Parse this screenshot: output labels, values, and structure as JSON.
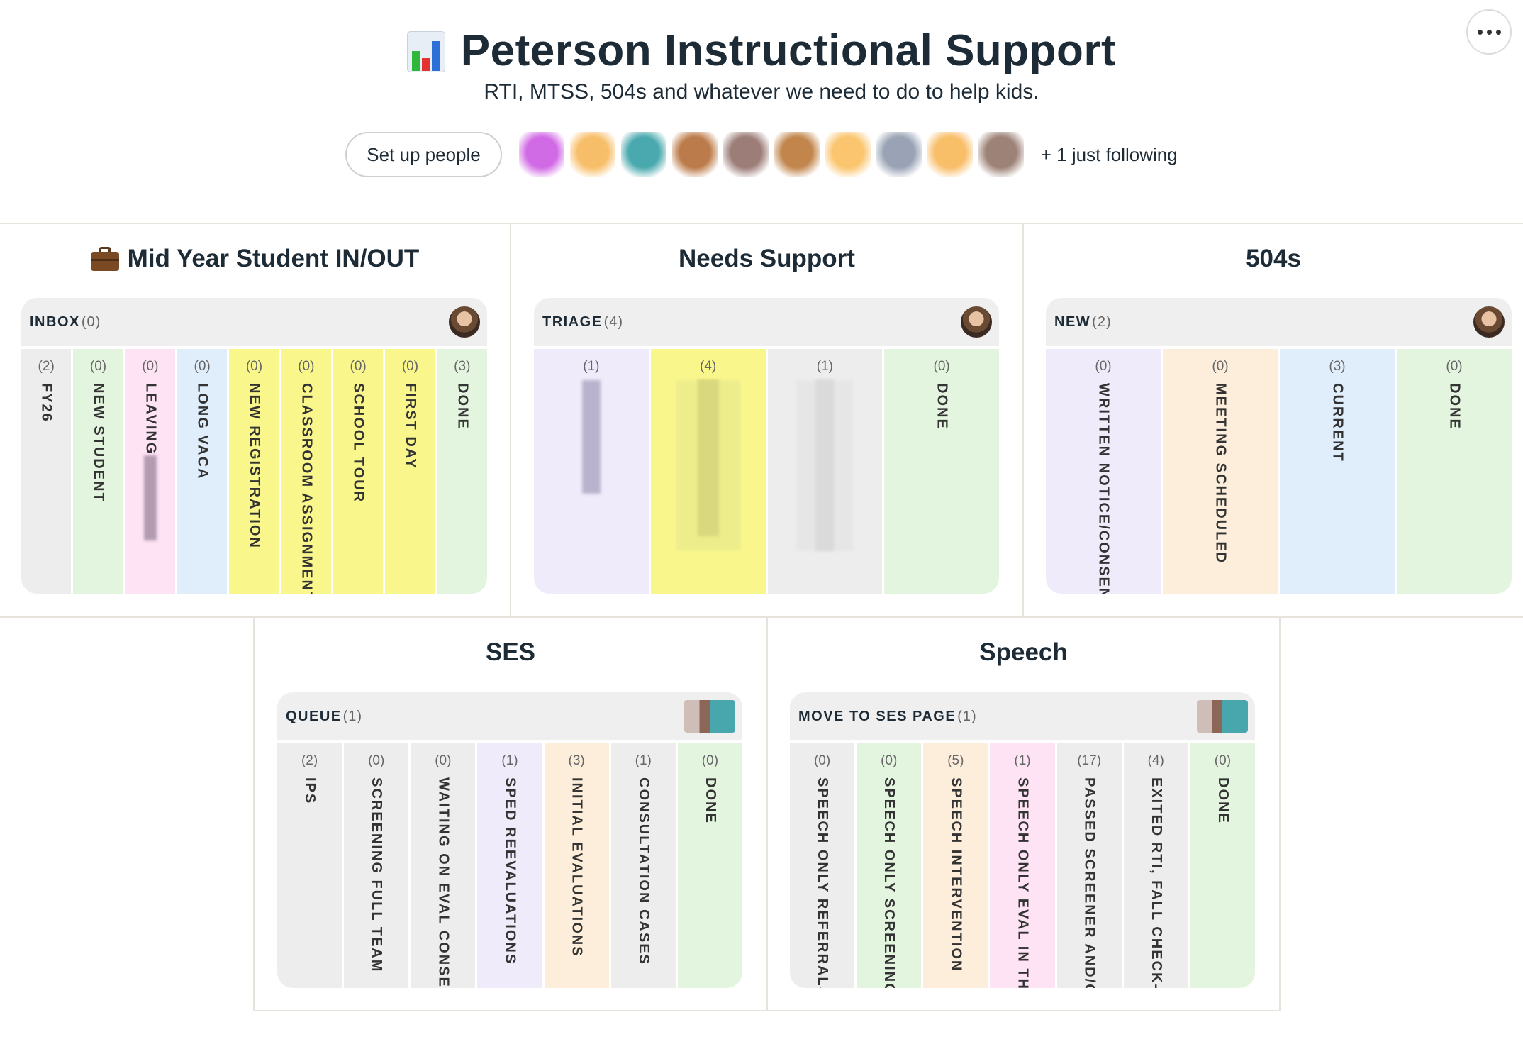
{
  "header": {
    "title": "Peterson Instructional Support",
    "subtitle": "RTI, MTSS, 504s and whatever we need to do to help kids.",
    "title_icon": "bar-chart-icon"
  },
  "people": {
    "setup_label": "Set up people",
    "following_label": "+ 1 just following",
    "avatar_colors": [
      "#c94fe0",
      "#f6b34f",
      "#2a9aa0",
      "#b0642a",
      "#8a6660",
      "#b7712d",
      "#f9bb55",
      "#8893a8",
      "#f8b24e",
      "#8c6c5f"
    ]
  },
  "more_menu": {
    "icon": "more-horizontal-icon"
  },
  "projects": [
    {
      "title": "Mid Year Student IN/OUT",
      "icon": "briefcase-icon",
      "board": {
        "name": "INBOX",
        "count": "(0)",
        "columns": [
          {
            "count": "(2)",
            "name": "FY26",
            "color": "#ededed"
          },
          {
            "count": "(0)",
            "name": "NEW STUDENT",
            "color": "#e3f5df"
          },
          {
            "count": "(0)",
            "name": "LEAVING",
            "color": "#fde3f4"
          },
          {
            "count": "(0)",
            "name": "LONG VACA",
            "color": "#e0eefb"
          },
          {
            "count": "(0)",
            "name": "NEW REGISTRATION",
            "color": "#f9f78c"
          },
          {
            "count": "(0)",
            "name": "CLASSROOM ASSIGNMENT",
            "color": "#f9f78c"
          },
          {
            "count": "(0)",
            "name": "SCHOOL TOUR",
            "color": "#f9f78c"
          },
          {
            "count": "(0)",
            "name": "FIRST DAY",
            "color": "#f9f78c"
          },
          {
            "count": "(3)",
            "name": "DONE",
            "color": "#e3f5df"
          }
        ]
      }
    },
    {
      "title": "Needs Support",
      "board": {
        "name": "TRIAGE",
        "count": "(4)",
        "columns": [
          {
            "count": "(1)",
            "name": "",
            "color": "#efebfb"
          },
          {
            "count": "(4)",
            "name": "",
            "color": "#f9f78c"
          },
          {
            "count": "(1)",
            "name": "",
            "color": "#ededed"
          },
          {
            "count": "(0)",
            "name": "DONE",
            "color": "#e3f5df"
          }
        ]
      }
    },
    {
      "title": "504s",
      "board": {
        "name": "NEW",
        "count": "(2)",
        "columns": [
          {
            "count": "(0)",
            "name": "WRITTEN NOTICE/CONSENT",
            "color": "#efebfb"
          },
          {
            "count": "(0)",
            "name": "MEETING SCHEDULED",
            "color": "#fdeedb"
          },
          {
            "count": "(3)",
            "name": "CURRENT",
            "color": "#e0eefb"
          },
          {
            "count": "(0)",
            "name": "DONE",
            "color": "#e3f5df"
          }
        ]
      }
    },
    {
      "title": "SES",
      "board": {
        "name": "QUEUE",
        "count": "(1)",
        "columns": [
          {
            "count": "(2)",
            "name": "IPS",
            "color": "#ededed"
          },
          {
            "count": "(0)",
            "name": "SCREENING FULL TEAM",
            "color": "#ededed"
          },
          {
            "count": "(0)",
            "name": "WAITING ON EVAL CONSENT",
            "color": "#ededed"
          },
          {
            "count": "(1)",
            "name": "SPED REEVALUATIONS",
            "color": "#efebfb"
          },
          {
            "count": "(3)",
            "name": "INITIAL EVALUATIONS",
            "color": "#fdeedb"
          },
          {
            "count": "(1)",
            "name": "CONSULTATION CASES",
            "color": "#ededed"
          },
          {
            "count": "(0)",
            "name": "DONE",
            "color": "#e3f5df"
          }
        ]
      }
    },
    {
      "title": "Speech",
      "board": {
        "name": "MOVE TO SES PAGE",
        "count": "(1)",
        "columns": [
          {
            "count": "(0)",
            "name": "SPEECH ONLY REFERRALS",
            "color": "#ededed"
          },
          {
            "count": "(0)",
            "name": "SPEECH ONLY SCREENINGS",
            "color": "#e3f5df"
          },
          {
            "count": "(5)",
            "name": "SPEECH INTERVENTION",
            "color": "#fdeedb"
          },
          {
            "count": "(1)",
            "name": "SPEECH ONLY EVAL IN THERAPY",
            "color": "#fde3f4"
          },
          {
            "count": "(17)",
            "name": "PASSED SCREENER AND/OR",
            "color": "#ededed"
          },
          {
            "count": "(4)",
            "name": "EXITED RTI, FALL CHECK-IN",
            "color": "#ededed"
          },
          {
            "count": "(0)",
            "name": "DONE",
            "color": "#e3f5df"
          }
        ]
      }
    }
  ]
}
